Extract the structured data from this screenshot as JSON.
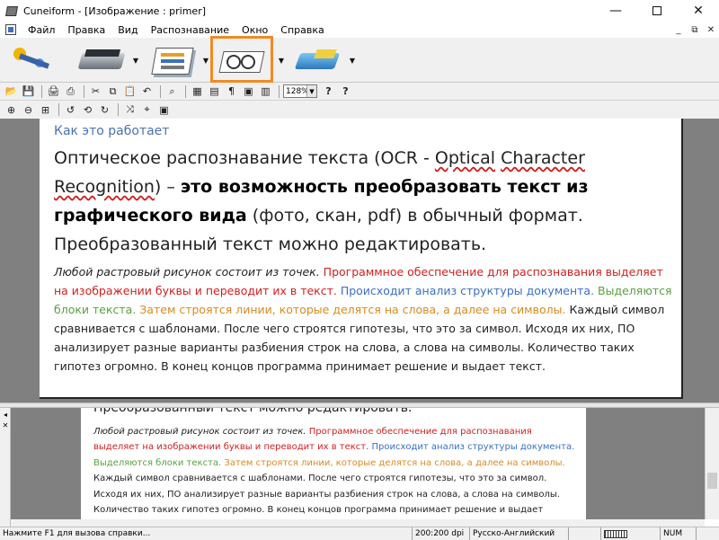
{
  "window": {
    "title": "Cuneiform - [Изображение : primer]",
    "controls": {
      "minimize": "—",
      "close": "✕"
    }
  },
  "menu": {
    "items": [
      "Файл",
      "Правка",
      "Вид",
      "Распознавание",
      "Окно",
      "Справка"
    ],
    "mdi_controls": [
      "_",
      "⧉",
      "✕"
    ]
  },
  "big_toolbar": {
    "buttons": [
      "magic-wand-icon",
      "scanner-icon",
      "layout-icon",
      "recognize-icon",
      "save-icon"
    ],
    "highlight_color": "#f08a24"
  },
  "toolbar": {
    "row1": {
      "open": "📂",
      "save": "💾",
      "print": "🖨",
      "print_preview": "⎙",
      "cut": "✂",
      "copy": "⧉",
      "paste": "📋",
      "undo": "↶",
      "find": "⌕",
      "table": "▦",
      "format": "▤",
      "paragraph": "¶",
      "frame": "▣",
      "columns": "▥",
      "zoom": "128%",
      "dd": "▼",
      "help": "?",
      "context_help": "?"
    },
    "row2": {
      "zoom_in": "⊕",
      "zoom_out": "⊖",
      "fit": "⊞",
      "rotate_ccw": "↺",
      "rotate_180": "⟲",
      "rotate_cw": "↻",
      "tool_a": "⤨",
      "tool_b": "⌖",
      "tool_c": "▣"
    }
  },
  "image": {
    "heading": "Как это работает",
    "lead": {
      "p1": "Оптическое распознавание текста (OCR - ",
      "w1": "Optical",
      "p2": " ",
      "w2": "Character",
      "p3": " ",
      "w3": "Recognition",
      "p4": ") – ",
      "bold1": "это возможность преобразовать текст из графического вида",
      "p5": " (фото, скан, pdf) в обычный формат. Преобразованный текст можно редактировать."
    },
    "body": {
      "s1": "Любой растровый рисунок состоит из точек.",
      "s2": "Программное обеспечение для распознавания выделяет на изображении буквы и переводит их в текст.",
      "s3": "Происходит анализ структуры документа.",
      "s4": "Выделяются блоки текста.",
      "s5": "Затем строятся линии, которые делятся на слова, а далее на символы.",
      "s6": "Каждый символ сравнивается с шаблонами. После чего строятся гипотезы, что это за символ. Исходя их них, ПО анализирует разные варианты разбиения строк на слова, а слова на символы. Количество таких гипотез огромно. В конец концов программа принимает решение и выдает текст."
    }
  },
  "lower_panel": {
    "cut_line": "Преобразованный текст можно редактировать.",
    "s1": "Любой растровый рисунок состоит из точек.",
    "s2": "Программное обеспечение для распознавания выделяет на изображении буквы и переводит их в текст.",
    "s3": "Происходит анализ структуры документа.",
    "s4": "Выделяются блоки текста.",
    "s5": "Затем строятся линии, которые делятся на слова, а далее на символы.",
    "s6": "Каждый символ сравнивается с шаблонами. После чего строятся гипотезы, что это за символ. Исходя их них, ПО анализирует разные варианты разбиения строк на слова, а слова на символы. Количество таких гипотез огромно. В конец концов программа принимает решение и выдает",
    "side": [
      "◂",
      "✕"
    ]
  },
  "status": {
    "hint": "Нажмите F1 для вызова справки...",
    "dpi": "200:200 dpi",
    "language": "Русско-Английский",
    "num": "NUM"
  }
}
